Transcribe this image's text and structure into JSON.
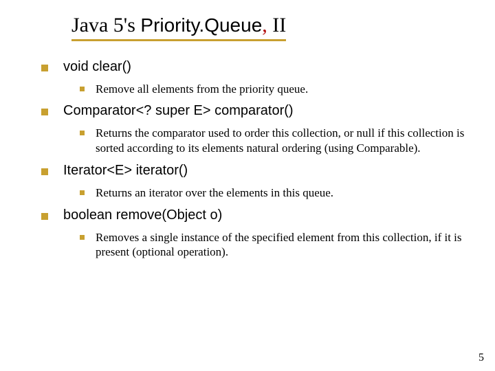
{
  "title": {
    "prefix": "Java 5's ",
    "code": "Priority.Queue",
    "comma": ", ",
    "suffix": "II"
  },
  "items": [
    {
      "signature": "void clear()",
      "descriptions": [
        "Remove all elements from the priority queue."
      ]
    },
    {
      "signature": "Comparator<? super E> comparator()",
      "descriptions": [
        "Returns the comparator used to order this collection, or null if this collection is sorted according to its elements natural ordering (using Comparable)."
      ]
    },
    {
      "signature": "Iterator<E> iterator()",
      "descriptions": [
        "Returns an iterator over the elements in this queue."
      ]
    },
    {
      "signature": "boolean remove(Object o)",
      "descriptions": [
        "Removes a single instance of the specified element from this collection, if it is present (optional operation)."
      ]
    }
  ],
  "page_number": "5"
}
